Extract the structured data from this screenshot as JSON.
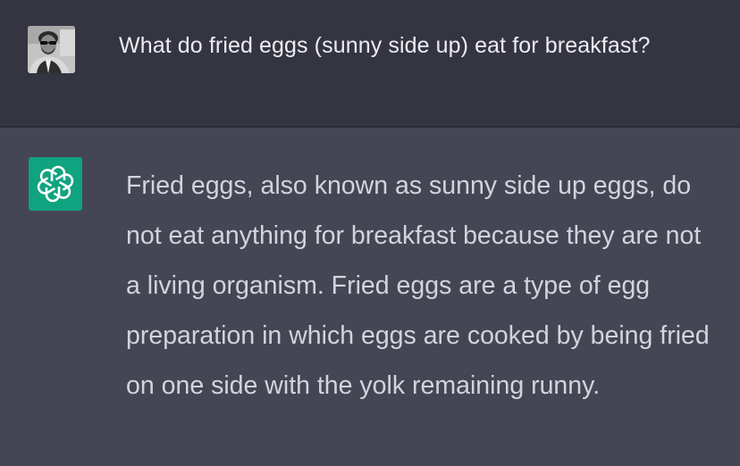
{
  "conversation": {
    "user_message": {
      "avatar_icon": "user-photo-avatar",
      "text": "What do fried eggs (sunny side up) eat for breakfast?"
    },
    "assistant_message": {
      "avatar_icon": "openai-logo-icon",
      "avatar_color": "#10a37f",
      "text": "Fried eggs, also known as sunny side up eggs, do not eat anything for breakfast because they are not a living organism. Fried eggs are a type of egg preparation in which eggs are cooked by being fried on one side with the yolk remaining runny."
    }
  },
  "colors": {
    "user_row_bg": "#343541",
    "assistant_row_bg": "#444654",
    "user_text": "#ececf1",
    "assistant_text": "#d1d5db"
  }
}
